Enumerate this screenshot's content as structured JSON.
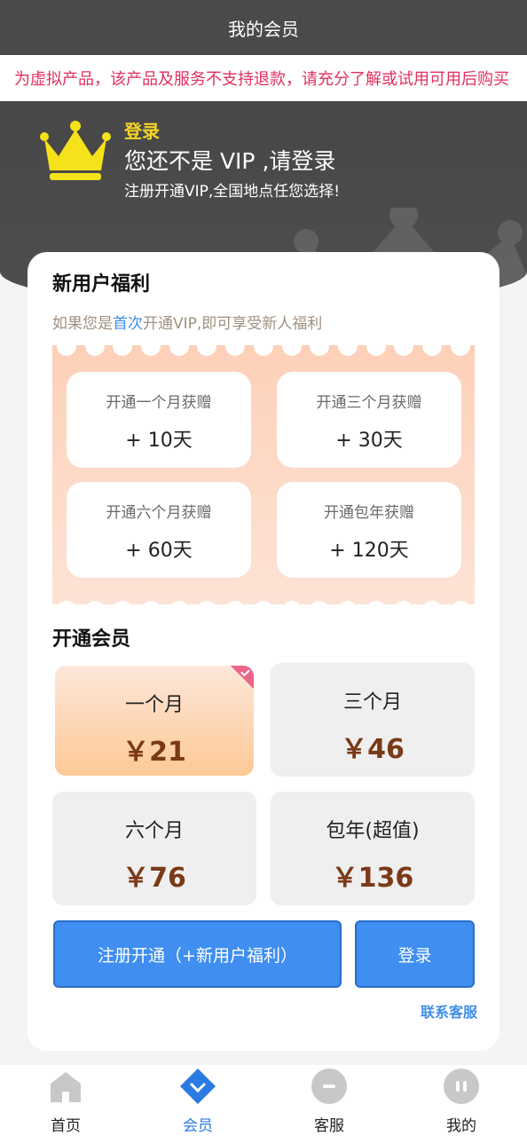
{
  "header": {
    "title": "我的会员"
  },
  "notice": {
    "text": "为虚拟产品，该产品及服务不支持退款，请充分了解或试用可用后购买"
  },
  "hero": {
    "login_link": "登录",
    "title": "您还不是 VIP ,请登录",
    "subtitle": "注册开通VIP,全国地点任您选择!"
  },
  "new_user": {
    "title": "新用户福利",
    "tip_prefix": "如果您是",
    "tip_highlight": "首次",
    "tip_suffix": "开通VIP,即可享受新人福利",
    "benefits": [
      {
        "label": "开通一个月获赠",
        "value": "+ 10天"
      },
      {
        "label": "开通三个月获赠",
        "value": "+ 30天"
      },
      {
        "label": "开通六个月获赠",
        "value": "+ 60天"
      },
      {
        "label": "开通包年获赠",
        "value": "+ 120天"
      }
    ]
  },
  "membership": {
    "title": "开通会员",
    "plans": [
      {
        "name": "一个月",
        "price": "￥21",
        "selected": true
      },
      {
        "name": "三个月",
        "price": "￥46",
        "selected": false
      },
      {
        "name": "六个月",
        "price": "￥76",
        "selected": false
      },
      {
        "name": "包年(超值)",
        "price": "￥136",
        "selected": false
      }
    ],
    "register_button": "注册开通（+新用户福利）",
    "login_button": "登录",
    "contact_link": "联系客服"
  },
  "tabbar": {
    "items": [
      {
        "label": "首页",
        "icon": "home-icon",
        "active": false
      },
      {
        "label": "会员",
        "icon": "vip-diamond-icon",
        "active": true
      },
      {
        "label": "客服",
        "icon": "service-icon",
        "active": false
      },
      {
        "label": "我的",
        "icon": "profile-icon",
        "active": false
      }
    ]
  },
  "colors": {
    "accent_blue": "#3f8ef0",
    "crown_yellow": "#f5d626",
    "price_brown": "#7a3a16",
    "notice_red": "#e0305e"
  }
}
